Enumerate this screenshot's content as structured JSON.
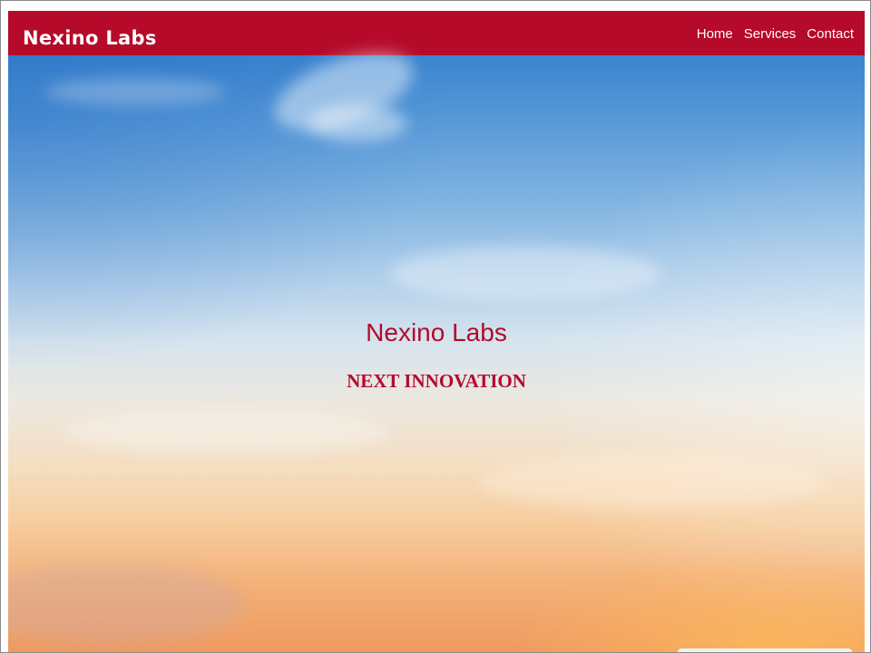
{
  "navbar": {
    "brand": "Nexino Labs",
    "links": [
      "Home",
      "Services",
      "Contact"
    ],
    "background": "#b50a29"
  },
  "hero": {
    "title": "Nexino Labs",
    "subtitle": "NEXT INNOVATION",
    "text_color": "#b50a29"
  }
}
